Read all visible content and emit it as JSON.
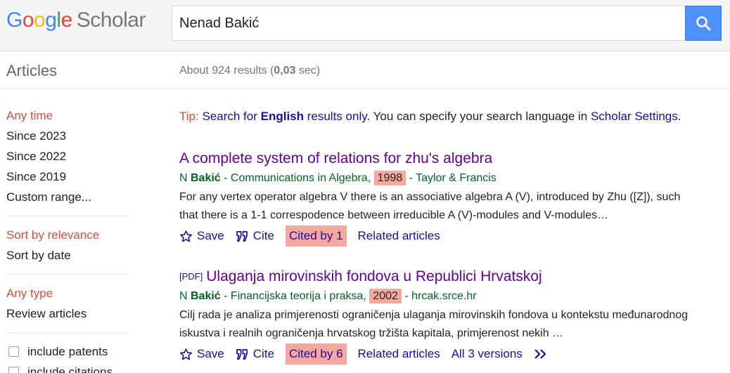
{
  "header": {
    "logo_scholar": "Scholar",
    "search_value": "Nenad Bakić"
  },
  "subheader": {
    "articles_label": "Articles",
    "results_prefix": "About 924 results (",
    "results_time": "0,03",
    "results_suffix": " sec)"
  },
  "sidebar": {
    "time": [
      "Any time",
      "Since 2023",
      "Since 2022",
      "Since 2019",
      "Custom range..."
    ],
    "sort": [
      "Sort by relevance",
      "Sort by date"
    ],
    "type": [
      "Any type",
      "Review articles"
    ],
    "checks": [
      "include patents",
      "include citations"
    ]
  },
  "tip": {
    "label": "Tip:",
    "link1_pre": "Search for ",
    "link1_bold": "English",
    "link1_post": " results only",
    "middle": ". You can specify your search language in ",
    "link2": "Scholar Settings",
    "end": "."
  },
  "results": [
    {
      "pdf": "",
      "title": "A complete system of relations for zhu's algebra",
      "author_initial": "N ",
      "author_bold": "Bakić",
      "venue": " - Communications in Algebra, ",
      "year": "1998",
      "publisher": " - Taylor & Francis",
      "snippet": "For any vertex operator algebra V there is an associative algebra A (V), introduced by Zhu ([Z]), such that there is a 1-1 correspodence between irreducible A (V)-modules and V-modules…",
      "save": "Save",
      "cite": "Cite",
      "cited_by": "Cited by 1",
      "related": "Related articles",
      "versions": ""
    },
    {
      "pdf": "[PDF]",
      "title": "Ulaganja mirovinskih fondova u Republici Hrvatskoj",
      "author_initial": "N ",
      "author_bold": "Bakić",
      "venue": " - Financijska teorija i praksa, ",
      "year": "2002",
      "publisher": " - hrcak.srce.hr",
      "snippet": "Cilj rada je analiza primjerenosti ograničenja ulaganja mirovinskih fondova u kontekstu međunarodnog iskustva i realnih ograničenja hrvatskog tržišta kapitala, primjerenost nekih …",
      "save": "Save",
      "cite": "Cite",
      "cited_by": "Cited by 6",
      "related": "Related articles",
      "versions": "All 3 versions"
    }
  ],
  "colors": {
    "accent_red": "#dd4b39",
    "link_blue": "#1a0dab",
    "visited_purple": "#660099",
    "meta_green": "#006621",
    "highlight": "#f6a89c",
    "search_blue": "#4d90fe"
  },
  "icons": [
    "search-icon",
    "star-icon",
    "quote-icon",
    "double-chevron-icon"
  ]
}
